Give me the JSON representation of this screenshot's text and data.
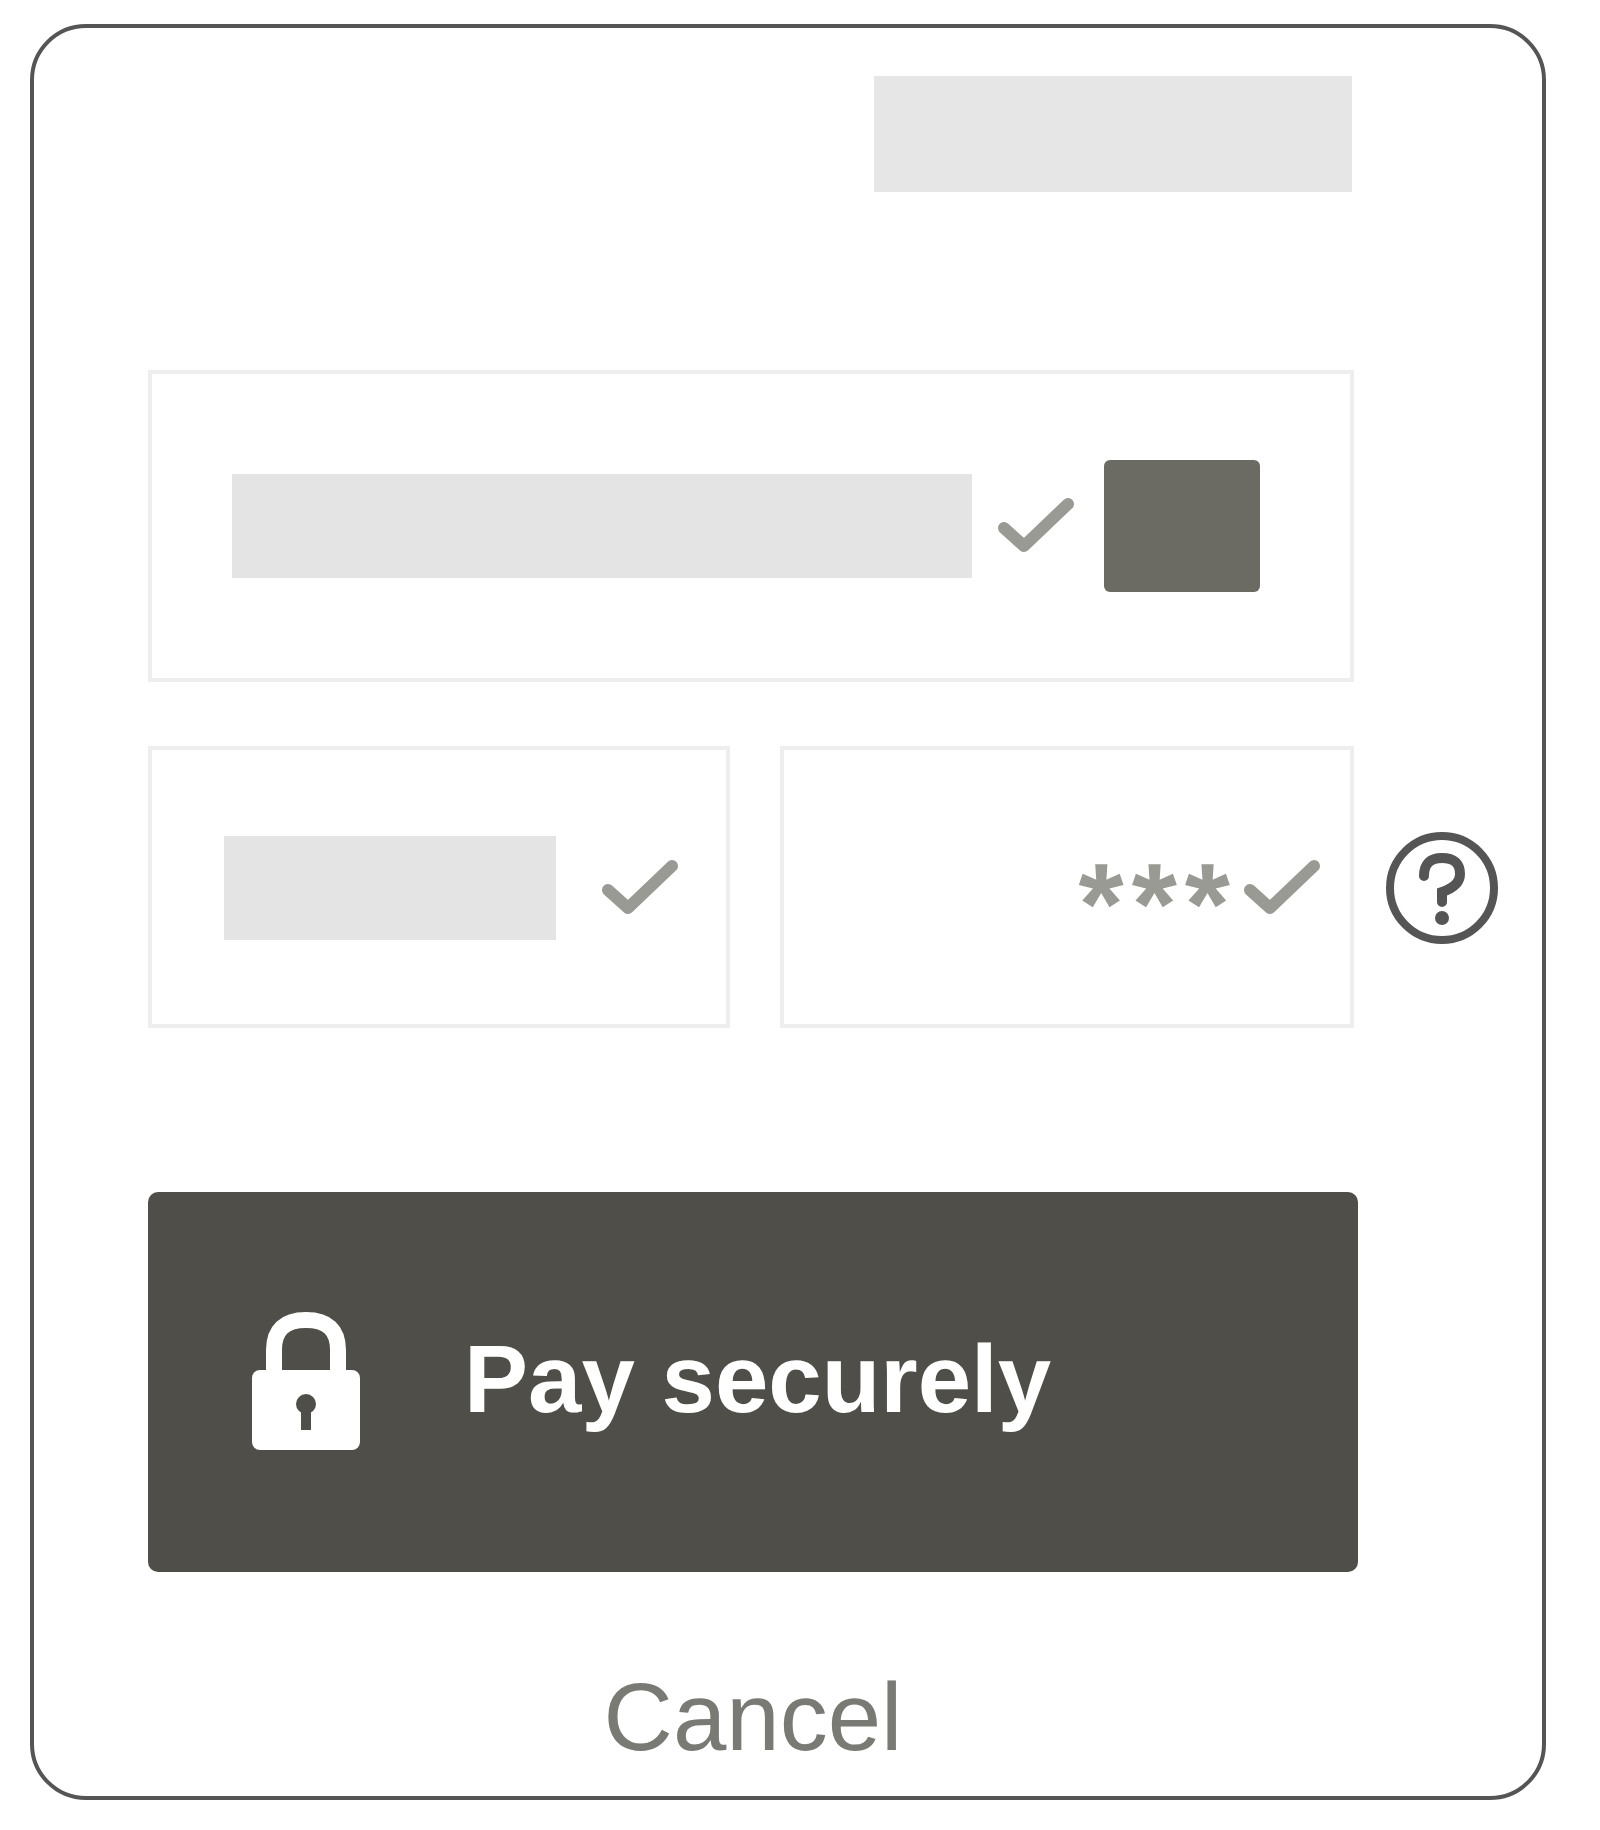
{
  "card_number_field": {
    "valid": true
  },
  "expiry_field": {
    "valid": true
  },
  "cvc_field": {
    "value": "***",
    "valid": true
  },
  "pay_button": {
    "label": "Pay securely"
  },
  "cancel_link": {
    "label": "Cancel"
  }
}
